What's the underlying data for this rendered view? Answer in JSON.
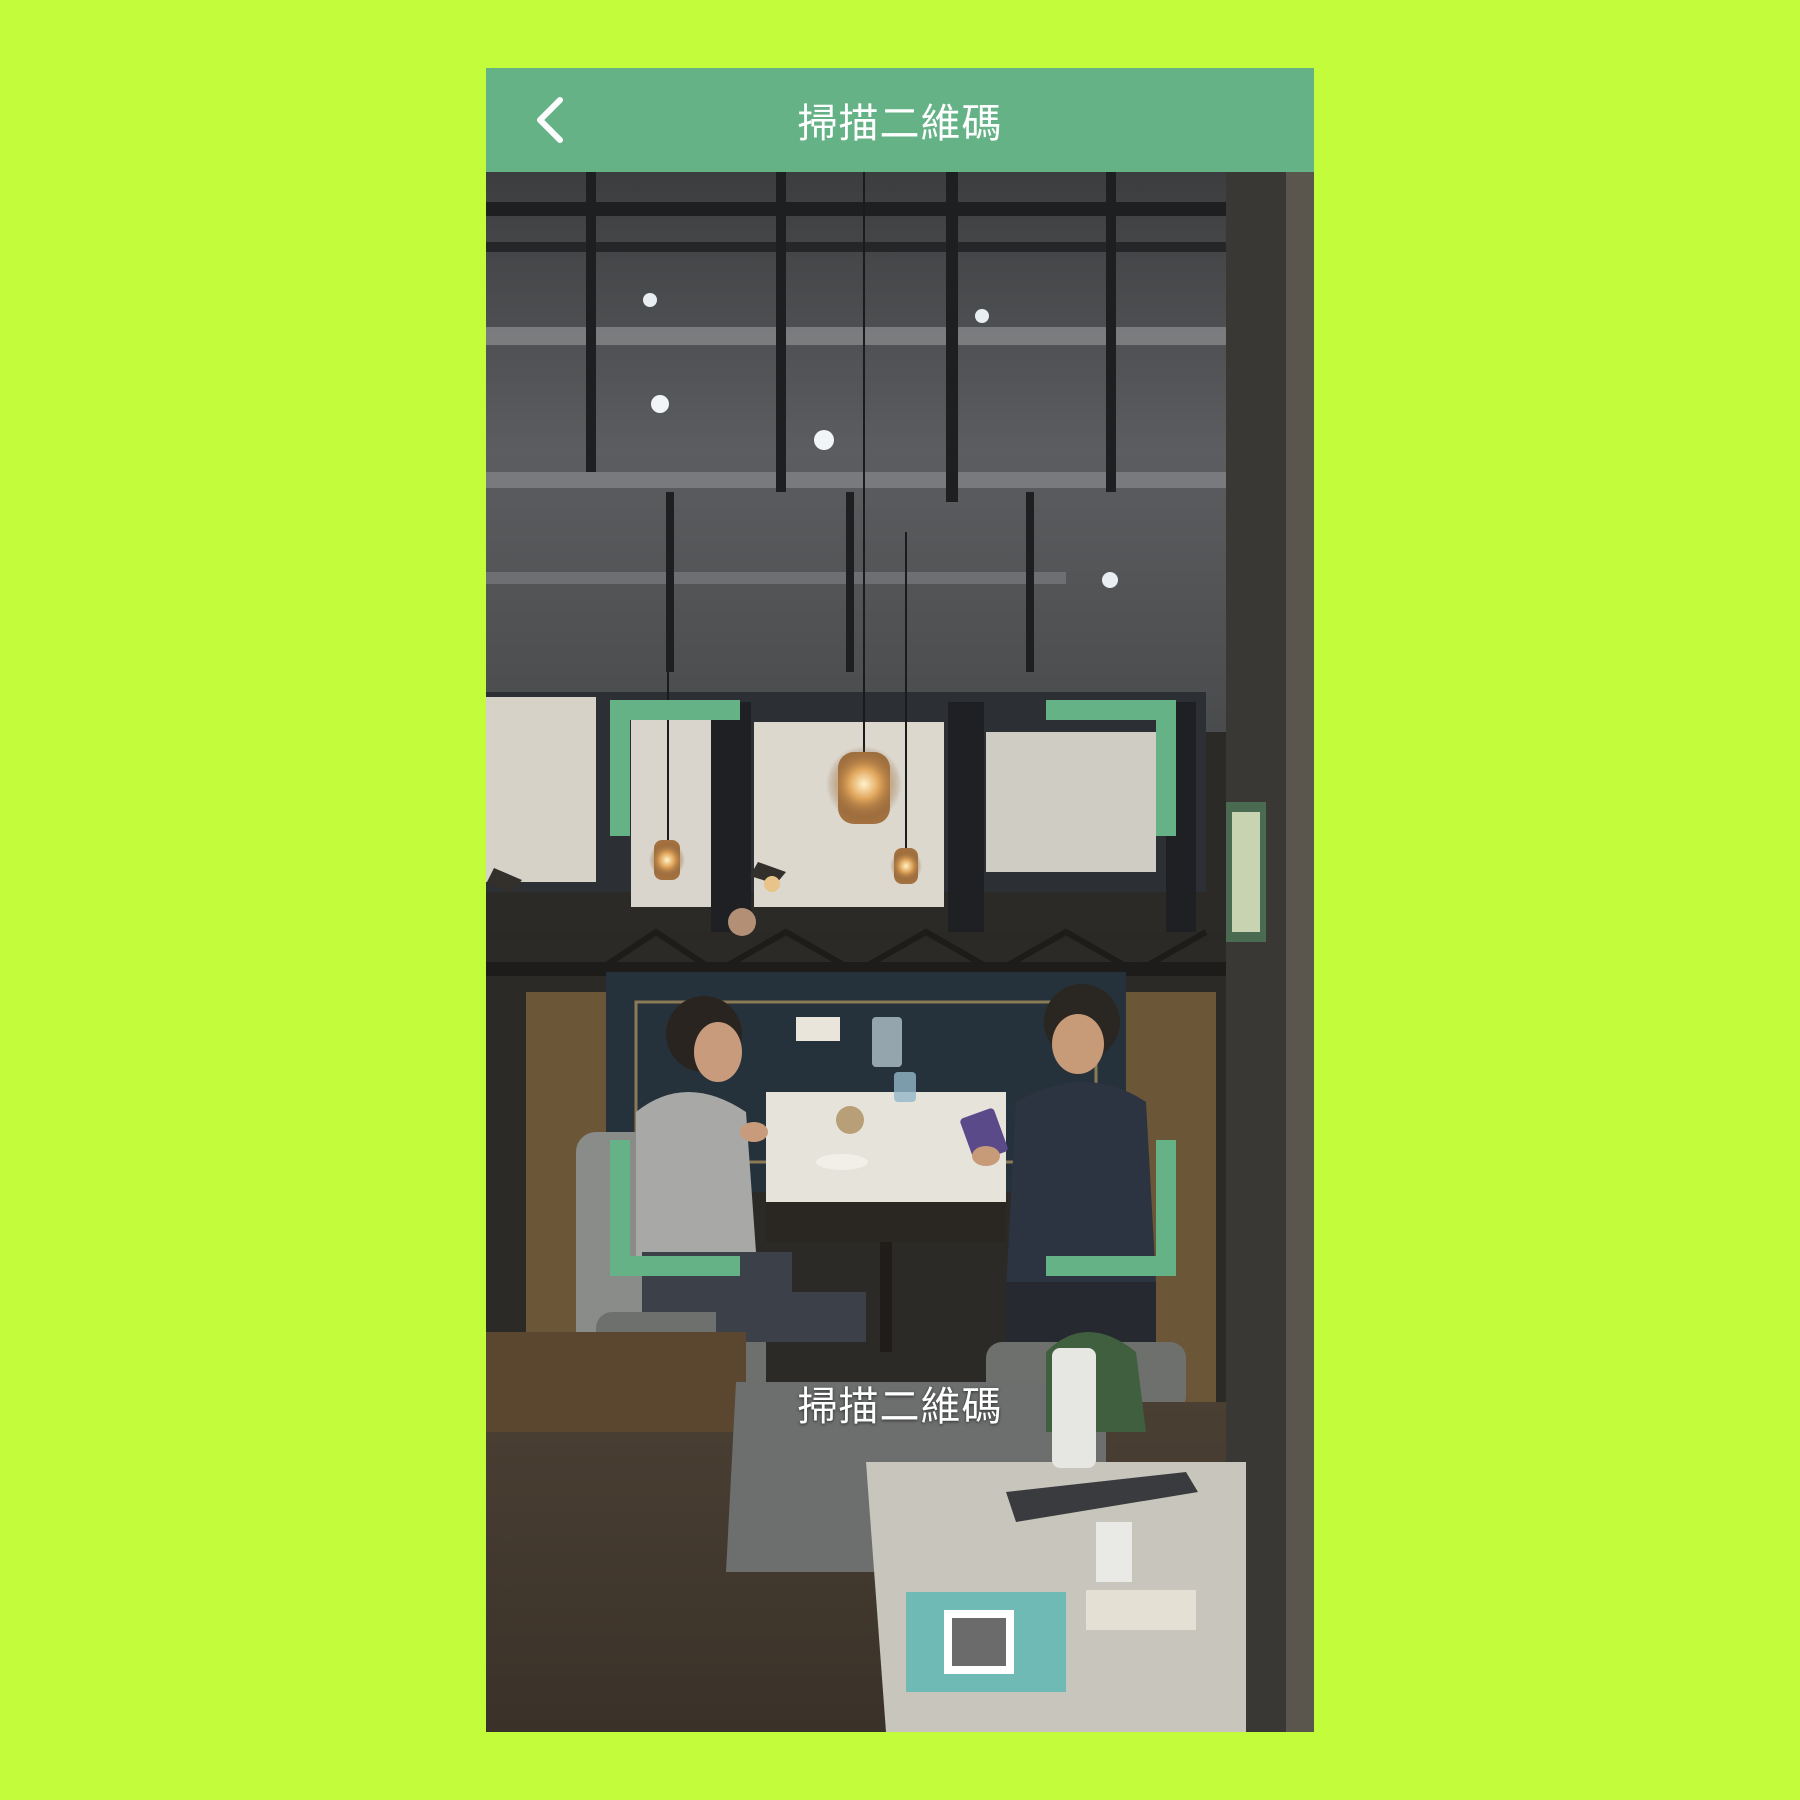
{
  "header": {
    "title": "掃描二維碼",
    "back_icon": "chevron-left-icon"
  },
  "scanner": {
    "label": "掃描二維碼"
  },
  "colors": {
    "background": "#c2fc3b",
    "accent": "#66b287",
    "text": "#ffffff"
  }
}
